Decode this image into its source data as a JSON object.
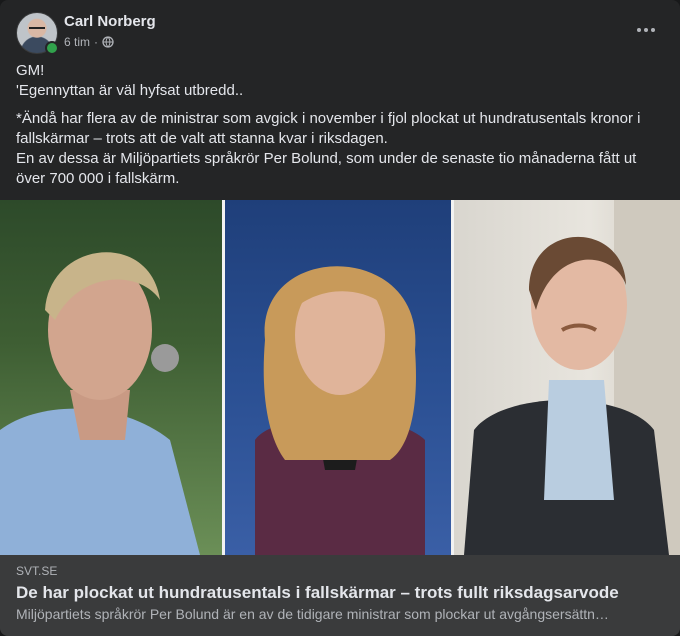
{
  "post": {
    "author": "Carl Norberg",
    "timestamp": "6 tim",
    "separator": "·",
    "privacy_icon": "globe-icon",
    "more_icon": "more-options-icon",
    "online": true,
    "text": {
      "line1": "GM!",
      "line2": "'Egennyttan är väl hyfsat utbredd..",
      "line3": "*Ändå har flera av de ministrar som avgick i november i fjol plockat ut hundratusentals kronor i fallskärmar – trots att de valt att stanna kvar i riksdagen.",
      "line4": "En av dessa är Miljöpartiets språkrör Per Bolund, som under de senaste tio månaderna fått ut över 700 000 i fallskärm."
    }
  },
  "link_preview": {
    "domain": "SVT.SE",
    "title": "De har plockat ut hundratusentals i fallskärmar – trots fullt riksdagsarvode",
    "description": "Miljöpartiets språkrör Per Bolund är en av de tidigare ministrar som plockar ut avgångsersättn…"
  },
  "colors": {
    "card_bg": "#242526",
    "link_bg": "#3a3b3c",
    "text_primary": "#e4e6eb",
    "text_secondary": "#b0b3b8",
    "online_green": "#31a24c"
  }
}
